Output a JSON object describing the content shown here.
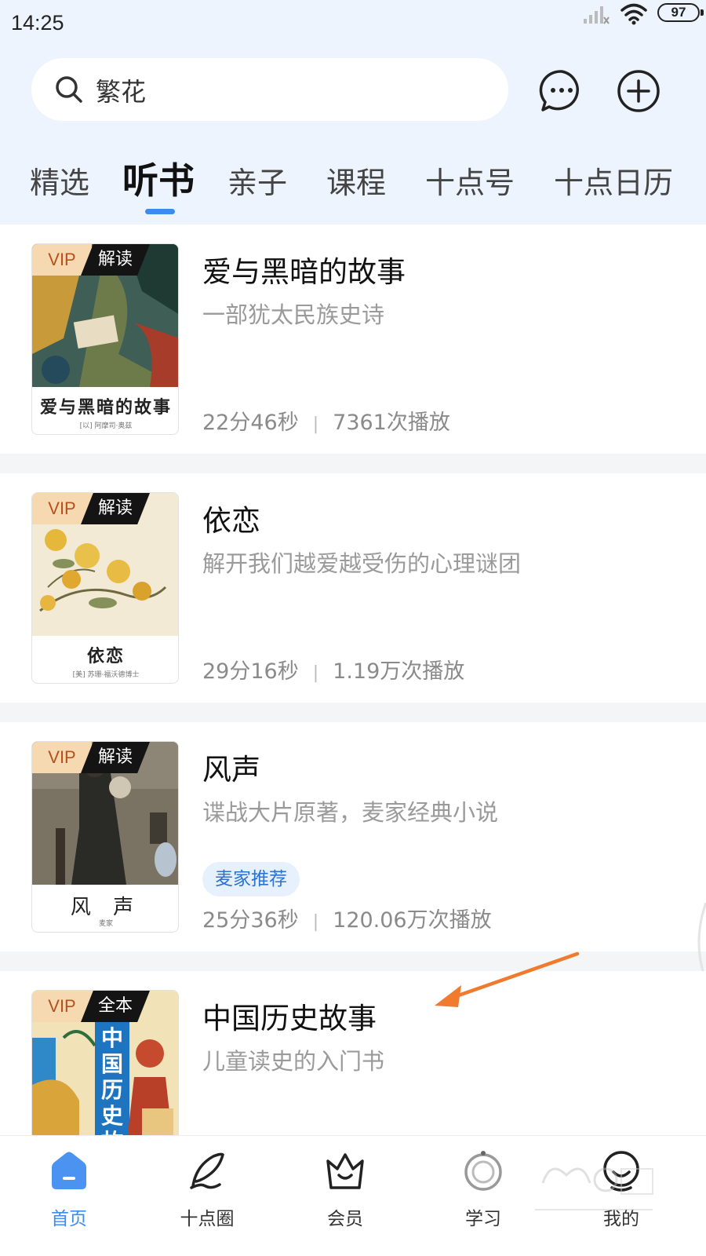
{
  "status": {
    "time": "14:25",
    "battery": "97"
  },
  "search": {
    "text": "繁花"
  },
  "tabs": [
    {
      "label": "精选"
    },
    {
      "label": "听书"
    },
    {
      "label": "亲子"
    },
    {
      "label": "课程"
    },
    {
      "label": "十点号"
    },
    {
      "label": "十点日历"
    }
  ],
  "cards": [
    {
      "badge_vip": "VIP",
      "badge_type": "解读",
      "title": "爱与黑暗的故事",
      "subtitle": "一部犹太民族史诗",
      "duration": "22分46秒",
      "plays": "7361次播放",
      "cover_title": "爱与黑暗的故事",
      "cover_author": "[以] 阿摩司·奥兹"
    },
    {
      "badge_vip": "VIP",
      "badge_type": "解读",
      "title": "依恋",
      "subtitle": "解开我们越爱越受伤的心理谜团",
      "duration": "29分16秒",
      "plays": "1.19万次播放",
      "cover_title": "依恋",
      "cover_author": "[美] 苏珊·福沃德博士"
    },
    {
      "badge_vip": "VIP",
      "badge_type": "解读",
      "title": "风声",
      "subtitle": "谍战大片原著，麦家经典小说",
      "tag": "麦家推荐",
      "duration": "25分36秒",
      "plays": "120.06万次播放",
      "cover_title": "风 声",
      "cover_author": "麦家"
    },
    {
      "badge_vip": "VIP",
      "badge_type": "全本",
      "title": "中国历史故事",
      "subtitle": "儿童读史的入门书",
      "cover_title": "中国历史故事"
    }
  ],
  "bottom_nav": [
    {
      "label": "首页",
      "icon": "home-icon"
    },
    {
      "label": "十点圈",
      "icon": "feather-icon"
    },
    {
      "label": "会员",
      "icon": "crown-icon"
    },
    {
      "label": "学习",
      "icon": "study-icon"
    },
    {
      "label": "我的",
      "icon": "profile-icon"
    }
  ],
  "colors": {
    "accent": "#3d8bef",
    "vip_bg": "#f6d9b0",
    "vip_text": "#b4521f",
    "arrow": "#f07a2e"
  }
}
